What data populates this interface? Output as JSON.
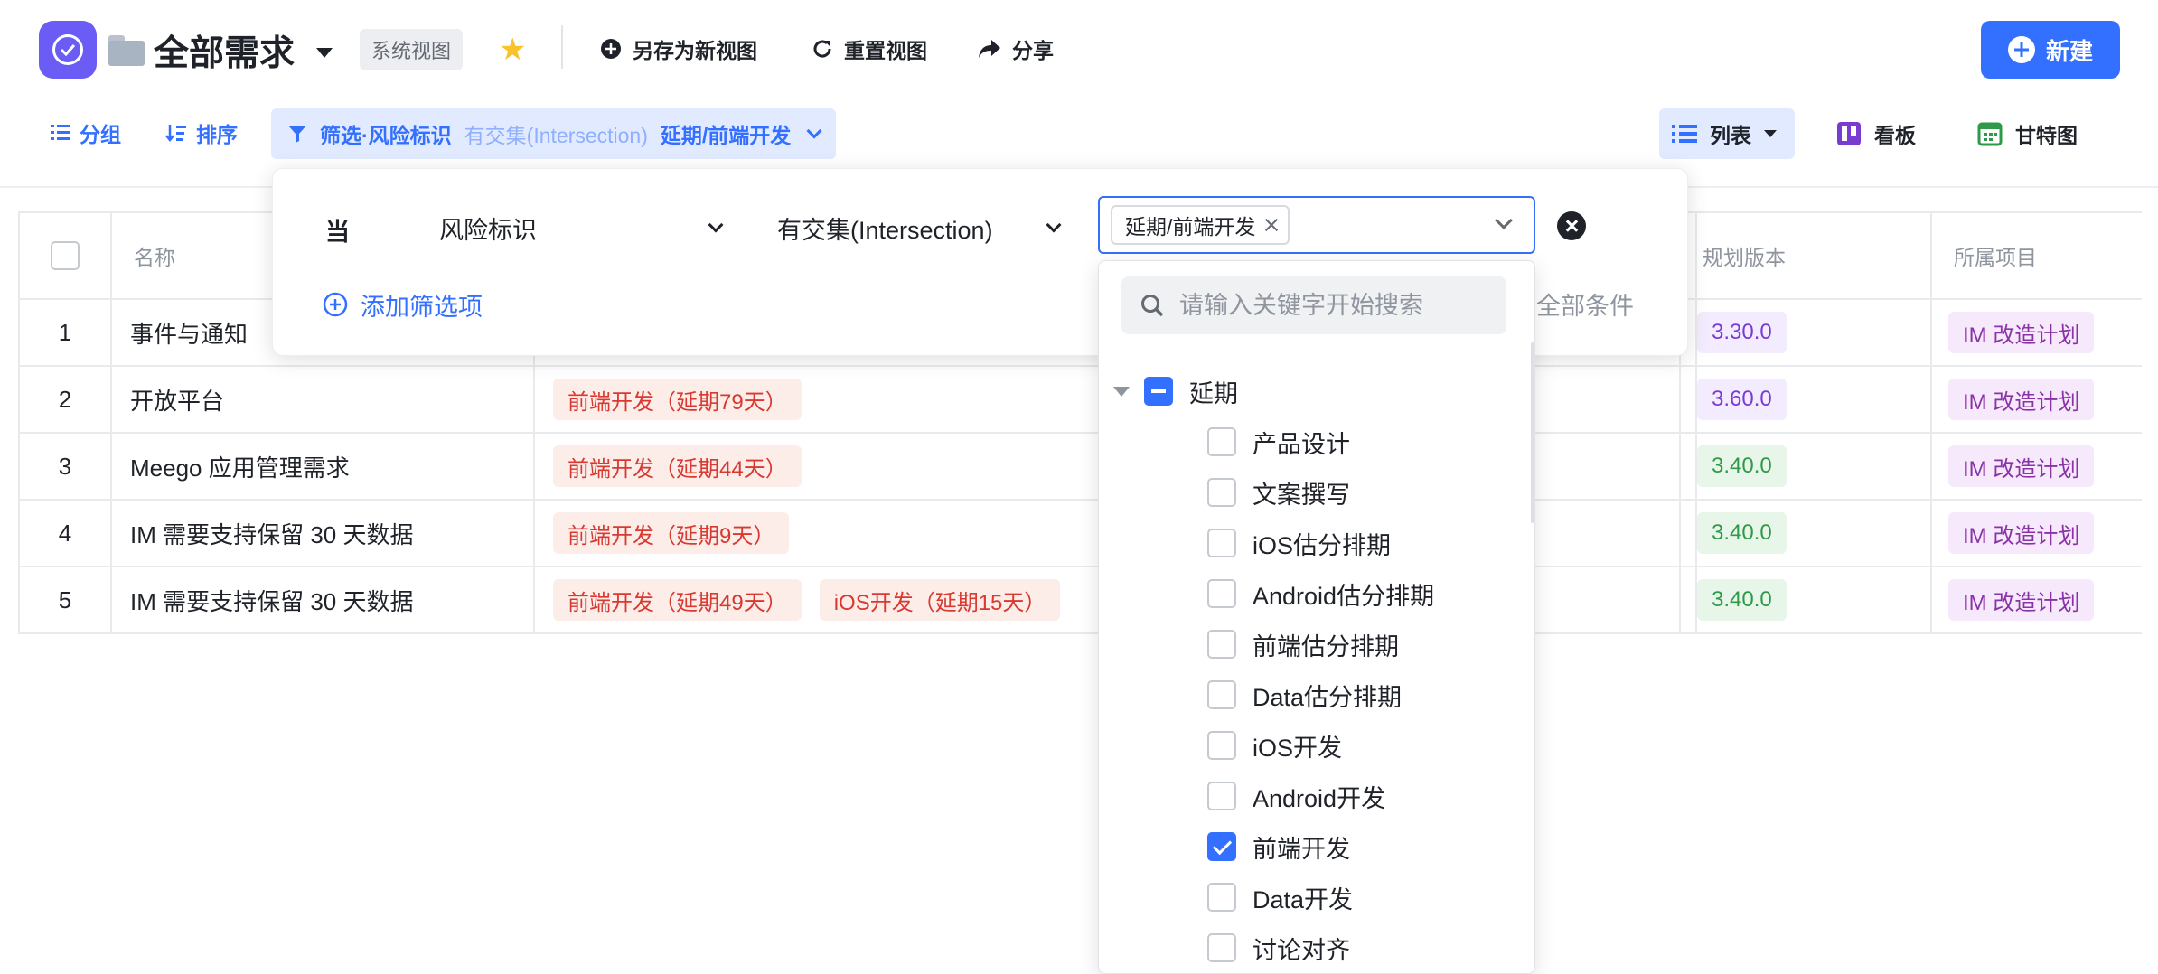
{
  "header": {
    "title": "全部需求",
    "system_view": "系统视图",
    "save_as_view": "另存为新视图",
    "reset_view": "重置视图",
    "share": "分享",
    "new_button": "新建"
  },
  "toolbar": {
    "group": "分组",
    "sort": "排序",
    "filter_label": "筛选·风险标识",
    "filter_operator": "有交集(Intersection)",
    "filter_value": "延期/前端开发",
    "views": [
      "列表",
      "看板",
      "甘特图"
    ]
  },
  "filter_panel": {
    "when": "当",
    "field": "风险标识",
    "operator": "有交集(Intersection)",
    "selected_value": "延期/前端开发",
    "add_filter": "添加筛选项",
    "all_conditions": "全部条件"
  },
  "dropdown": {
    "search_placeholder": "请输入关键字开始搜索",
    "group": {
      "label": "延期",
      "state": "partial"
    },
    "options": [
      {
        "label": "产品设计",
        "checked": false
      },
      {
        "label": "文案撰写",
        "checked": false
      },
      {
        "label": "iOS估分排期",
        "checked": false
      },
      {
        "label": "Android估分排期",
        "checked": false
      },
      {
        "label": "前端估分排期",
        "checked": false
      },
      {
        "label": "Data估分排期",
        "checked": false
      },
      {
        "label": "iOS开发",
        "checked": false
      },
      {
        "label": "Android开发",
        "checked": false
      },
      {
        "label": "前端开发",
        "checked": true
      },
      {
        "label": "Data开发",
        "checked": false
      },
      {
        "label": "讨论对齐",
        "checked": false
      }
    ]
  },
  "table": {
    "columns": {
      "name": "名称",
      "version": "规划版本",
      "project": "所属项目"
    },
    "rows": [
      {
        "index": "1",
        "name": "事件与通知",
        "risks": [],
        "version": "3.30.0",
        "version_color": "purple",
        "project": "IM 改造计划"
      },
      {
        "index": "2",
        "name": "开放平台",
        "risks": [
          "前端开发（延期79天）"
        ],
        "version": "3.60.0",
        "version_color": "purple",
        "project": "IM 改造计划"
      },
      {
        "index": "3",
        "name": "Meego 应用管理需求",
        "risks": [
          "前端开发（延期44天）"
        ],
        "version": "3.40.0",
        "version_color": "green",
        "project": "IM 改造计划"
      },
      {
        "index": "4",
        "name": "IM 需要支持保留 30 天数据",
        "risks": [
          "前端开发（延期9天）"
        ],
        "version": "3.40.0",
        "version_color": "green",
        "project": "IM 改造计划"
      },
      {
        "index": "5",
        "name": "IM 需要支持保留 30 天数据",
        "risks": [
          "前端开发（延期49天）",
          "iOS开发（延期15天）"
        ],
        "version": "3.40.0",
        "version_color": "green",
        "project": "IM 改造计划"
      }
    ]
  },
  "colors": {
    "accent": "#3370ff",
    "app_icon": "#6b5cf5",
    "risk_red": "#d83931",
    "star": "#f7c22a"
  }
}
